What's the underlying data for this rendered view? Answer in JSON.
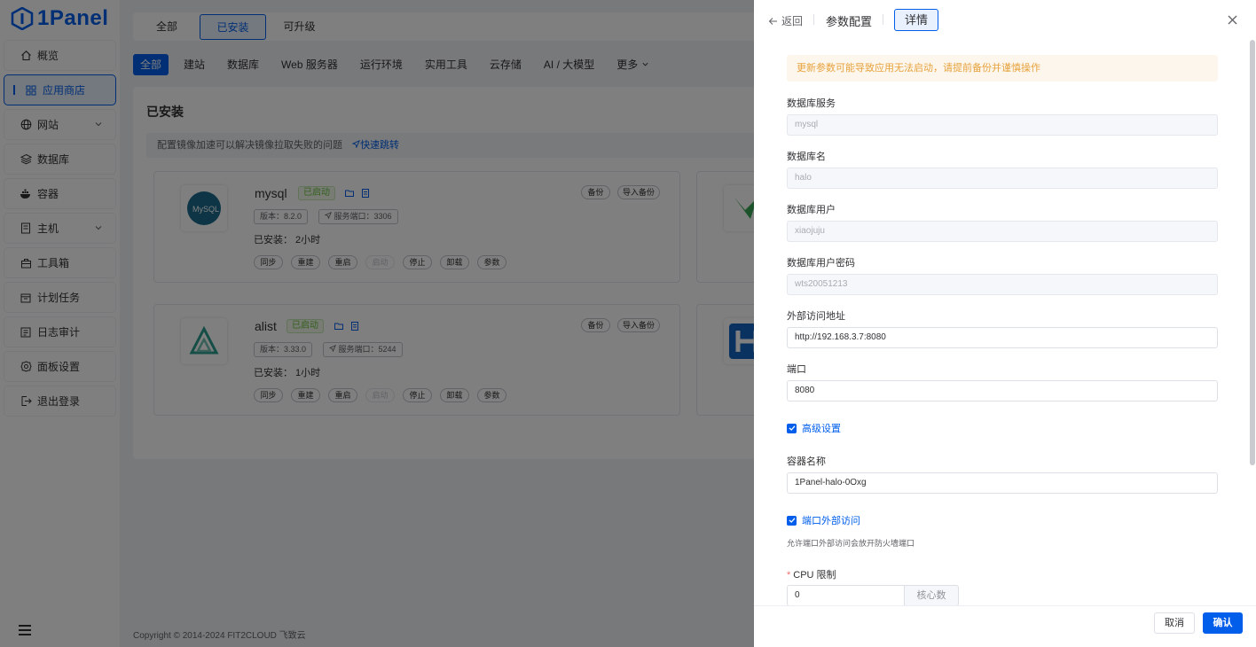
{
  "brand": {
    "name": "1Panel"
  },
  "sidebar": {
    "items": [
      {
        "label": "概览",
        "icon": "home-icon"
      },
      {
        "label": "应用商店",
        "icon": "grid-icon",
        "active": true
      },
      {
        "label": "网站",
        "icon": "globe-icon",
        "expandable": true
      },
      {
        "label": "数据库",
        "icon": "layers-icon"
      },
      {
        "label": "容器",
        "icon": "docker-icon"
      },
      {
        "label": "主机",
        "icon": "server-icon",
        "expandable": true
      },
      {
        "label": "工具箱",
        "icon": "toolbox-icon"
      },
      {
        "label": "计划任务",
        "icon": "calendar-icon"
      },
      {
        "label": "日志审计",
        "icon": "log-icon"
      },
      {
        "label": "面板设置",
        "icon": "gear-icon"
      },
      {
        "label": "退出登录",
        "icon": "logout-icon"
      }
    ]
  },
  "tabs": [
    "全部",
    "已安装",
    "可升级"
  ],
  "categories": [
    "全部",
    "建站",
    "数据库",
    "Web 服务器",
    "运行环境",
    "实用工具",
    "云存储",
    "AI / 大模型",
    "更多"
  ],
  "installed_panel": {
    "title": "已安装",
    "notice": "配置镜像加速可以解决镜像拉取失败的问题",
    "notice_link": "快速跳转",
    "apps": [
      {
        "name": "mysql",
        "status": "已启动",
        "version": "版本：8.2.0",
        "port": "服务端口：3306",
        "installed": "已安装：  2小时"
      },
      {
        "name": "alist",
        "status": "已启动",
        "version": "版本：3.33.0",
        "port": "服务端口：5244",
        "installed": "已安装：  1小时"
      }
    ],
    "card_actions": [
      "同步",
      "重建",
      "重启",
      "启动",
      "停止",
      "卸载",
      "参数"
    ],
    "card_buttons": [
      "备份",
      "导入备份"
    ]
  },
  "footer": {
    "copyright": "Copyright © 2014-2024 FIT2CLOUD 飞致云"
  },
  "drawer": {
    "back_label": "返回",
    "title": "参数配置",
    "detail_tab": "详情",
    "warning": "更新参数可能导致应用无法启动，请提前备份并谨慎操作",
    "fields": {
      "db_service": {
        "label": "数据库服务",
        "value": "mysql"
      },
      "db_name": {
        "label": "数据库名",
        "value": "halo"
      },
      "db_user": {
        "label": "数据库用户",
        "value": "xiaojuju"
      },
      "db_password": {
        "label": "数据库用户密码",
        "value": "wts20051213"
      },
      "external_url": {
        "label": "外部访问地址",
        "value": "http://192.168.3.7:8080"
      },
      "port": {
        "label": "端口",
        "value": "8080"
      },
      "container_name": {
        "label": "容器名称",
        "value": "1Panel-halo-0Oxg"
      },
      "cpu_limit": {
        "label": "CPU 限制",
        "value": "0",
        "unit": "核心数"
      }
    },
    "advanced_label": "高级设置",
    "port_external_label": "端口外部访问",
    "port_external_hint": "允许端口外部访问会放开防火墙端口",
    "cancel_label": "取消",
    "confirm_label": "确认"
  },
  "colors": {
    "primary": "#005eeb",
    "success": "#67c23a",
    "warning": "#e6a23c"
  }
}
